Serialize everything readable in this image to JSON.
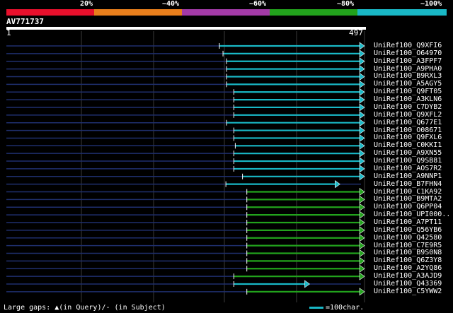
{
  "legend": {
    "labels": [
      "20%",
      "~40%",
      "~60%",
      "~80%",
      "~100%"
    ],
    "colors": [
      "#e8102c",
      "#e97f1c",
      "#a33aa7",
      "#22a21c",
      "#19b8c6"
    ]
  },
  "query": {
    "name": "AV771737",
    "length": 497,
    "scale_start": "1",
    "scale_end": "497"
  },
  "hits": [
    {
      "name": "UniRef100_Q9XFI6",
      "start": 296,
      "end": 497,
      "color": "#19b8c6"
    },
    {
      "name": "UniRef100_O64970",
      "start": 301,
      "end": 497,
      "color": "#19b8c6"
    },
    {
      "name": "UniRef100_A3FPF7",
      "start": 306,
      "end": 497,
      "color": "#19b8c6"
    },
    {
      "name": "UniRef100_A9PHA0",
      "start": 306,
      "end": 497,
      "color": "#19b8c6"
    },
    {
      "name": "UniRef100_B9RXL3",
      "start": 306,
      "end": 497,
      "color": "#19b8c6"
    },
    {
      "name": "UniRef100_A5AGY5",
      "start": 306,
      "end": 497,
      "color": "#19b8c6"
    },
    {
      "name": "UniRef100_Q9FT05",
      "start": 316,
      "end": 497,
      "color": "#19b8c6"
    },
    {
      "name": "UniRef100_A3KLN6",
      "start": 316,
      "end": 497,
      "color": "#19b8c6"
    },
    {
      "name": "UniRef100_C7DYB2",
      "start": 316,
      "end": 497,
      "color": "#19b8c6"
    },
    {
      "name": "UniRef100_Q9XFL2",
      "start": 316,
      "end": 497,
      "color": "#19b8c6"
    },
    {
      "name": "UniRef100_Q677E1",
      "start": 306,
      "end": 497,
      "color": "#19b8c6"
    },
    {
      "name": "UniRef100_O08671",
      "start": 316,
      "end": 497,
      "color": "#19b8c6"
    },
    {
      "name": "UniRef100_Q9FXL6",
      "start": 316,
      "end": 497,
      "color": "#19b8c6"
    },
    {
      "name": "UniRef100_C0KKI1",
      "start": 318,
      "end": 497,
      "color": "#19b8c6"
    },
    {
      "name": "UniRef100_A9XN55",
      "start": 316,
      "end": 497,
      "color": "#19b8c6"
    },
    {
      "name": "UniRef100_Q9SB81",
      "start": 316,
      "end": 497,
      "color": "#19b8c6"
    },
    {
      "name": "UniRef100_AOS7R2",
      "start": 316,
      "end": 497,
      "color": "#19b8c6"
    },
    {
      "name": "UniRef100_A9NNP1",
      "start": 328,
      "end": 497,
      "color": "#19b8c6"
    },
    {
      "name": "UniRef100_B7FHN4",
      "start": 305,
      "end": 463,
      "color": "#19b8c6"
    },
    {
      "name": "UniRef100_C1KA92",
      "start": 334,
      "end": 497,
      "color": "#22a21c"
    },
    {
      "name": "UniRef100_B9MTA2",
      "start": 334,
      "end": 497,
      "color": "#22a21c"
    },
    {
      "name": "UniRef100_Q6PP04",
      "start": 334,
      "end": 497,
      "color": "#22a21c"
    },
    {
      "name": "UniRef100_UPI000..",
      "start": 334,
      "end": 497,
      "color": "#22a21c"
    },
    {
      "name": "UniRef100_A7PT11",
      "start": 334,
      "end": 497,
      "color": "#22a21c"
    },
    {
      "name": "UniRef100_Q56YB6",
      "start": 334,
      "end": 497,
      "color": "#22a21c"
    },
    {
      "name": "UniRef100_Q42580",
      "start": 334,
      "end": 497,
      "color": "#22a21c"
    },
    {
      "name": "UniRef100_C7E9R5",
      "start": 334,
      "end": 497,
      "color": "#22a21c"
    },
    {
      "name": "UniRef100_B9S0N8",
      "start": 334,
      "end": 497,
      "color": "#22a21c"
    },
    {
      "name": "UniRef100_Q6Z3Y8",
      "start": 334,
      "end": 497,
      "color": "#22a21c"
    },
    {
      "name": "UniRef100_A2YQ86",
      "start": 334,
      "end": 497,
      "color": "#22a21c"
    },
    {
      "name": "UniRef100_A3AJD9",
      "start": 316,
      "end": 497,
      "color": "#22a21c"
    },
    {
      "name": "UniRef100_Q43369",
      "start": 316,
      "end": 421,
      "color": "#19b8c6"
    },
    {
      "name": "UniRef100_C5YWW2",
      "start": 334,
      "end": 497,
      "color": "#22a21c"
    }
  ],
  "footer": {
    "gaps_text": "Large gaps: ▲(in Query)/- (in Subject)",
    "scale_key": "=100char."
  }
}
